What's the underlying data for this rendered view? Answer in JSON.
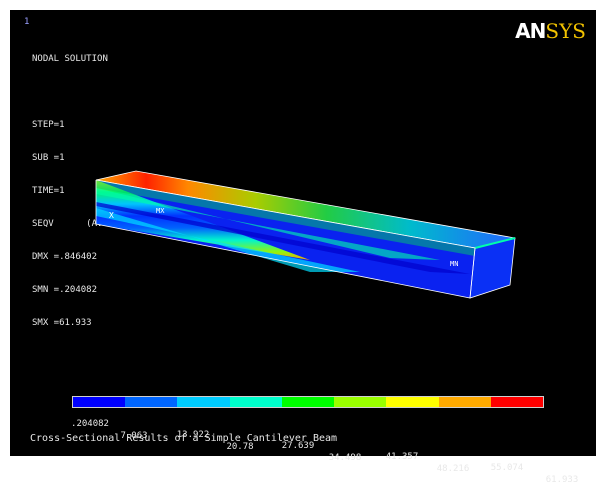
{
  "window_number": "1",
  "header": {
    "lines": [
      "NODAL SOLUTION",
      "",
      "STEP=1",
      "SUB =1",
      "TIME=1",
      "SEQV      (AVG)",
      "DMX =.846402",
      "SMN =.204082",
      "SMX =61.933"
    ]
  },
  "logo": {
    "part1": "AN",
    "part2": "SYS"
  },
  "markers": {
    "max": "MX",
    "min": "MN",
    "node": "X"
  },
  "legend": {
    "colors": [
      "#0000ff",
      "#0066ff",
      "#00ccff",
      "#00ffcc",
      "#00ff00",
      "#99ff00",
      "#ffff00",
      "#ffaa00",
      "#ff0000"
    ],
    "top_labels": [
      ".204082",
      "13.922",
      "27.639",
      "41.357",
      "55.074"
    ],
    "bottom_labels": [
      "7.063",
      "20.78",
      "34.498",
      "48.216",
      "61.933"
    ],
    "min_value": 0.204082,
    "max_value": 61.933
  },
  "caption": "Cross-Sectional Results of a Simple Cantilever Beam"
}
